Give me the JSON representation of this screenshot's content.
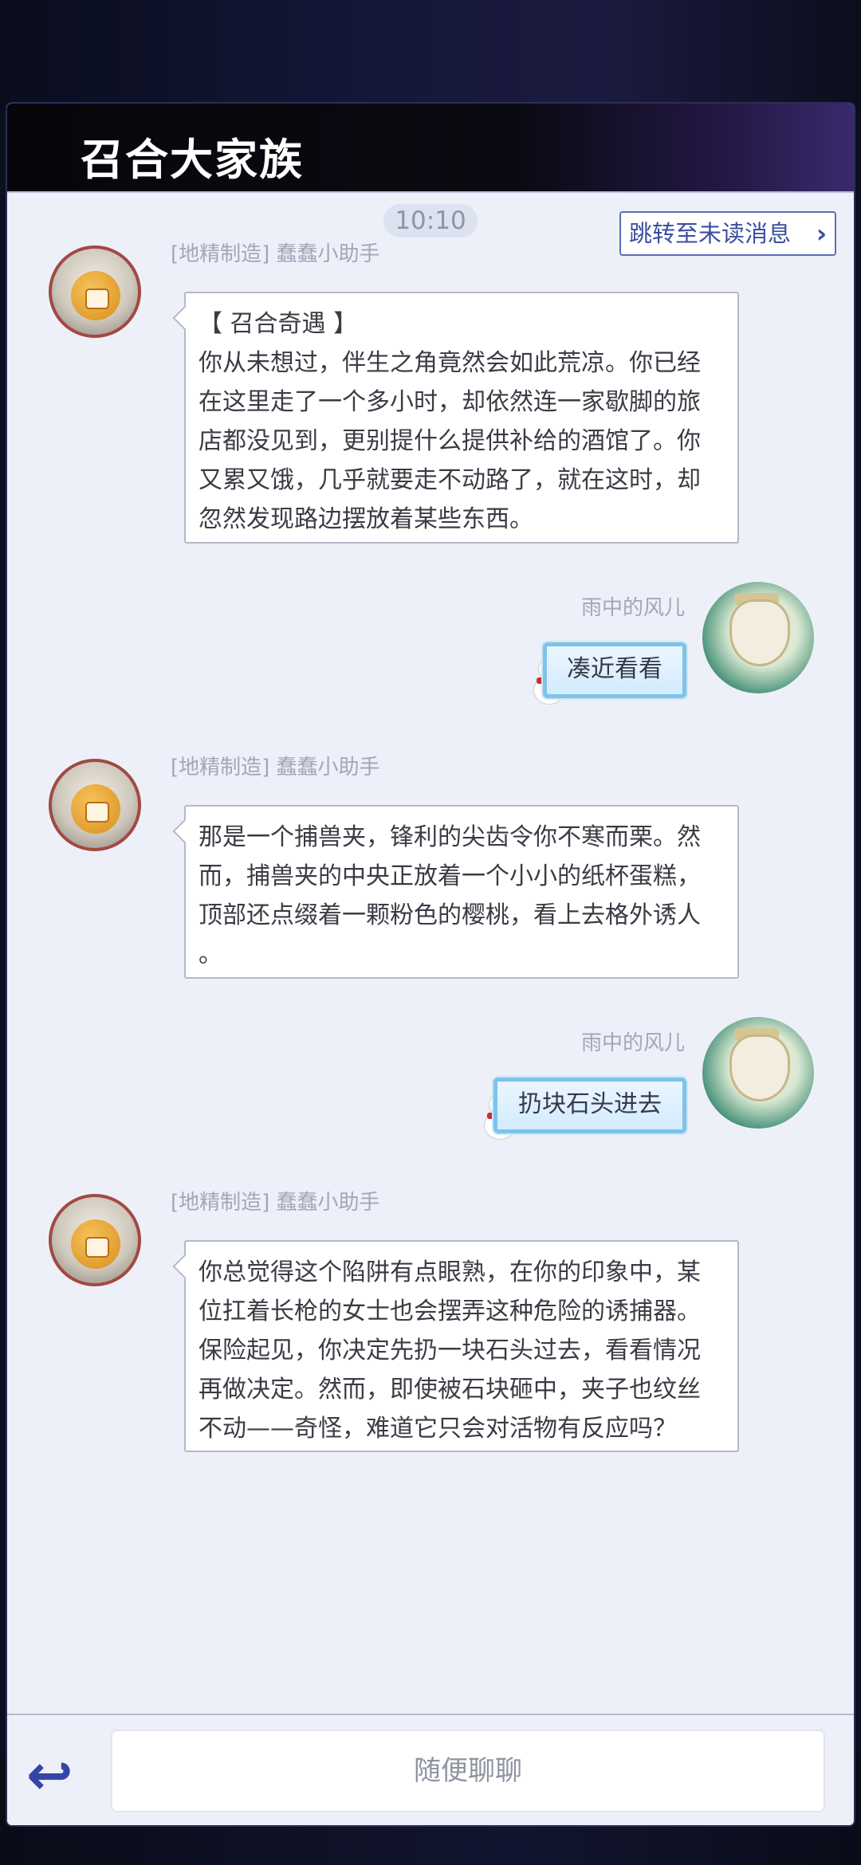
{
  "header": {
    "title": "召合大家族"
  },
  "timestamp": "10:10",
  "jump_button": {
    "label": "跳转至未读消息",
    "icon": "chevron-right-icon"
  },
  "messages": [
    {
      "sender": "[地精制造] 蠢蠢小助手",
      "side": "left",
      "lines": [
        "【 召合奇遇 】",
        "你从未想过，伴生之角竟然会如此荒凉。你已经",
        "在这里走了一个多小时，却依然连一家歇脚的旅",
        "店都没见到，更别提什么提供补给的酒馆了。你",
        "又累又饿，几乎就要走不动路了，就在这时，却",
        "忽然发现路边摆放着某些东西。"
      ]
    },
    {
      "sender": "雨中的风儿",
      "side": "right",
      "text": "凑近看看"
    },
    {
      "sender": "[地精制造] 蠢蠢小助手",
      "side": "left",
      "lines": [
        "那是一个捕兽夹，锋利的尖齿令你不寒而栗。然",
        "而，捕兽夹的中央正放着一个小小的纸杯蛋糕，",
        "顶部还点缀着一颗粉色的樱桃，看上去格外诱人",
        "。"
      ]
    },
    {
      "sender": "雨中的风儿",
      "side": "right",
      "text": "扔块石头进去"
    },
    {
      "sender": "[地精制造] 蠢蠢小助手",
      "side": "left",
      "lines": [
        "你总觉得这个陷阱有点眼熟，在你的印象中，某",
        "位扛着长枪的女士也会摆弄这种危险的诱捕器。",
        "保险起见，你决定先扔一块石头过去，看看情况",
        "再做决定。然而，即使被石块砸中，夹子也纹丝",
        "不动——奇怪，难道它只会对活物有反应吗？"
      ]
    }
  ],
  "footer": {
    "back_icon": "back-arrow-icon",
    "input_placeholder": "随便聊聊"
  },
  "colors": {
    "panel_bg": "#eef0f9",
    "accent": "#3445a8",
    "header_bg": "#06060b"
  }
}
